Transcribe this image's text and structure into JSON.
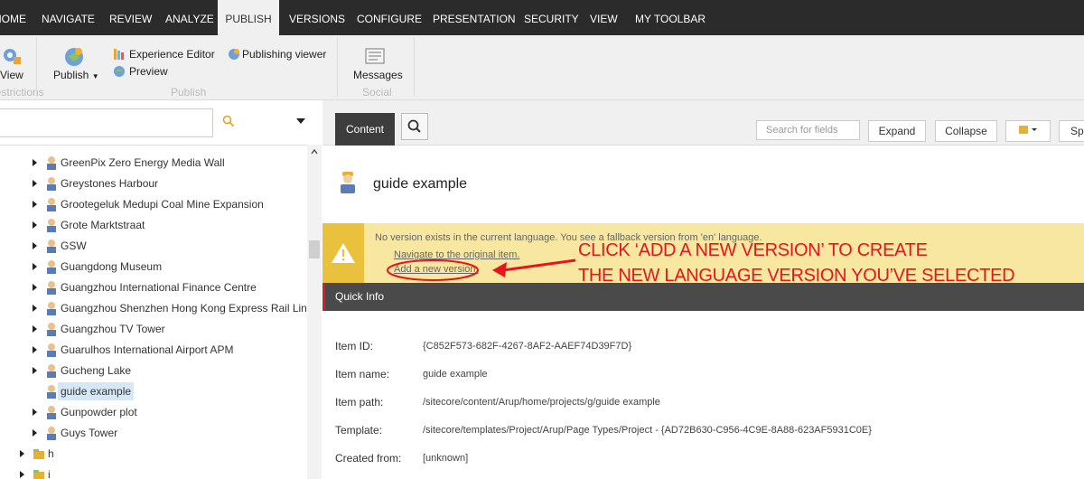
{
  "nav": {
    "tabs": [
      "HOME",
      "NAVIGATE",
      "REVIEW",
      "ANALYZE",
      "PUBLISH",
      "VERSIONS",
      "CONFIGURE",
      "PRESENTATION",
      "SECURITY",
      "VIEW",
      "MY TOOLBAR"
    ]
  },
  "ribbon": {
    "view_label": "View",
    "restrictions_label": "Restrictions",
    "publish_label": "Publish",
    "experience_editor": "Experience Editor",
    "preview": "Preview",
    "publishing_viewer": "Publishing viewer",
    "publish_group": "Publish",
    "messages_label": "Messages",
    "social_group": "Social"
  },
  "tree": {
    "items": [
      {
        "label": "GreenPix Zero Energy Media Wall"
      },
      {
        "label": "Greystones Harbour"
      },
      {
        "label": "Grootegeluk Medupi Coal Mine Expansion"
      },
      {
        "label": "Grote Marktstraat"
      },
      {
        "label": "GSW"
      },
      {
        "label": "Guangdong Museum"
      },
      {
        "label": "Guangzhou International Finance Centre"
      },
      {
        "label": "Guangzhou Shenzhen Hong Kong Express Rail Link"
      },
      {
        "label": "Guangzhou TV Tower"
      },
      {
        "label": "Guarulhos International Airport APM"
      },
      {
        "label": "Gucheng Lake"
      },
      {
        "label": "guide example"
      },
      {
        "label": "Gunpowder plot"
      },
      {
        "label": "Guys Tower"
      }
    ],
    "folders": [
      {
        "label": "h"
      },
      {
        "label": "i"
      }
    ]
  },
  "content": {
    "tab_label": "Content",
    "search_fields_placeholder": "Search for fields",
    "expand_label": "Expand",
    "collapse_label": "Collapse",
    "spell_label": "Sp",
    "item_title": "guide example",
    "warning_message": "No version exists in the current language. You see a fallback version from 'en' language.",
    "navigate_link": "Navigate to the original item.",
    "add_version_link": "Add a new version.",
    "annotation_line1": "CLICK ‘ADD A NEW VERSION’ TO CREATE",
    "annotation_line2": "THE NEW LANGUAGE VERSION YOU’VE SELECTED",
    "quick_info_label": "Quick Info",
    "fields": [
      {
        "label": "Item ID:",
        "value": "{C852F573-682F-4267-8AF2-AAEF74D39F7D}"
      },
      {
        "label": "Item name:",
        "value": "guide example"
      },
      {
        "label": "Item path:",
        "value": "/sitecore/content/Arup/home/projects/g/guide example"
      },
      {
        "label": "Template:",
        "value": "/sitecore/templates/Project/Arup/Page Types/Project - {AD72B630-C956-4C9E-8A88-623AF5931C0E}"
      },
      {
        "label": "Created from:",
        "value": "[unknown]"
      }
    ]
  },
  "colors": {
    "topnav_bg": "#2b2b2b",
    "ribbon_bg": "#f0f0f0",
    "warning_bg": "#f8e7a0",
    "warning_icon_bg": "#e9c13c",
    "annotation": "#e8141b",
    "quick_info_bg": "#4a4a4a",
    "selected_bg": "#d6e8f5"
  }
}
